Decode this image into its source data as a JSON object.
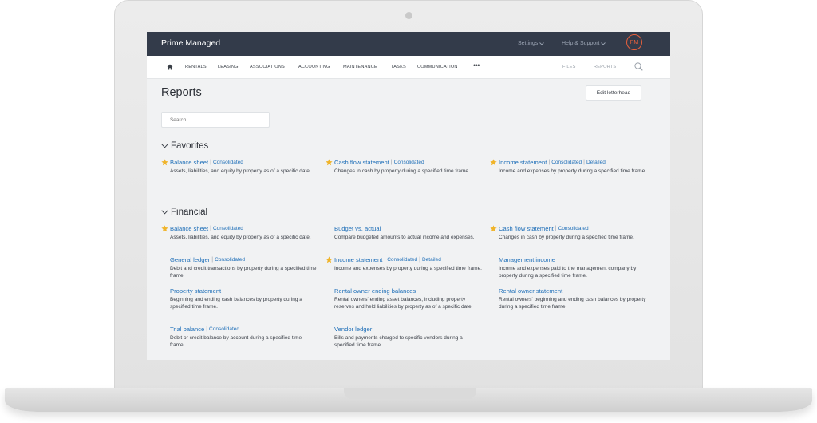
{
  "app": {
    "brand": "Prime Managed",
    "settings_label": "Settings",
    "help_label": "Help & Support",
    "avatar_initials": "PM",
    "accent_color": "#e8603c",
    "link_color": "#1f6fb8"
  },
  "nav": {
    "items": [
      "RENTALS",
      "LEASING",
      "ASSOCIATIONS",
      "ACCOUNTING",
      "MAINTENANCE",
      "TASKS",
      "COMMUNICATION"
    ],
    "right": [
      "FILES",
      "REPORTS"
    ]
  },
  "page": {
    "title": "Reports",
    "edit_letterhead": "Edit letterhead",
    "search_placeholder": "Search..."
  },
  "favorites": {
    "heading": "Favorites",
    "reports": [
      {
        "name": "Balance sheet",
        "links": [
          "Consolidated"
        ],
        "desc": "Assets, liabilities, and equity by property as of a specific date.",
        "starred": true
      },
      {
        "name": "Cash flow statement",
        "links": [
          "Consolidated"
        ],
        "desc": "Changes in cash by property during a specified time frame.",
        "starred": true
      },
      {
        "name": "Income statement",
        "links": [
          "Consolidated",
          "Detailed"
        ],
        "desc": "Income and expenses by property during a specified time frame.",
        "starred": true
      }
    ]
  },
  "financial": {
    "heading": "Financial",
    "reports": [
      {
        "name": "Balance sheet",
        "links": [
          "Consolidated"
        ],
        "desc": "Assets, liabilities, and equity by property as of a specific date.",
        "starred": true
      },
      {
        "name": "Budget vs. actual",
        "links": [],
        "desc": "Compare budgeted amounts to actual income and expenses.",
        "starred": false
      },
      {
        "name": "Cash flow statement",
        "links": [
          "Consolidated"
        ],
        "desc": "Changes in cash by property during a specified time frame.",
        "starred": true
      },
      {
        "name": "General ledger",
        "links": [
          "Consolidated"
        ],
        "desc": "Debit and credit transactions by property during a specified time frame.",
        "starred": false
      },
      {
        "name": "Income statement",
        "links": [
          "Consolidated",
          "Detailed"
        ],
        "desc": "Income and expenses by property during a specified time frame.",
        "starred": true
      },
      {
        "name": "Management income",
        "links": [],
        "desc": "Income and expenses paid to the management company by property during a specified time frame.",
        "starred": false
      },
      {
        "name": "Property statement",
        "links": [],
        "desc": "Beginning and ending cash balances by property during a specified time frame.",
        "starred": false
      },
      {
        "name": "Rental owner ending balances",
        "links": [],
        "desc": "Rental owners' ending asset balances, including property reserves and held liabilities by property as of a specific date.",
        "starred": false
      },
      {
        "name": "Rental owner statement",
        "links": [],
        "desc": "Rental owners' beginning and ending cash balances by property during a specified time frame.",
        "starred": false
      },
      {
        "name": "Trial balance",
        "links": [
          "Consolidated"
        ],
        "desc": "Debit or credit balance by account during a specified time frame.",
        "starred": false
      },
      {
        "name": "Vendor ledger",
        "links": [],
        "desc": "Bills and payments charged to specific vendors during a specified time frame.",
        "starred": false
      }
    ]
  }
}
